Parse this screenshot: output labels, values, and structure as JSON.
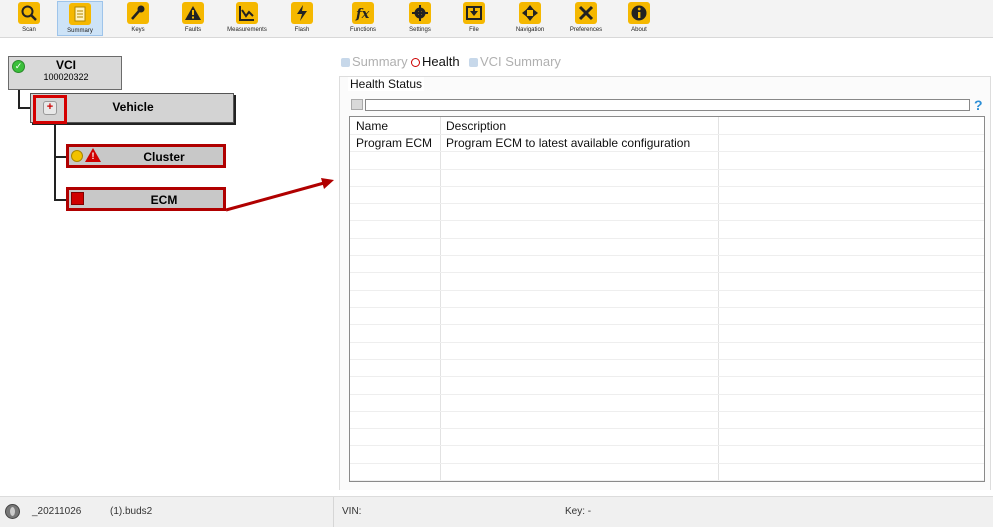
{
  "toolbar": {
    "buttons": [
      {
        "label": "Scan",
        "icon": "magnifier-icon"
      },
      {
        "label": "Summary",
        "icon": "document-icon"
      },
      {
        "label": "Keys",
        "icon": "key-icon"
      },
      {
        "label": "Faults",
        "icon": "warning-icon"
      },
      {
        "label": "Measurements",
        "icon": "chart-icon"
      },
      {
        "label": "Flash",
        "icon": "lightning-icon"
      },
      {
        "label": "Functions",
        "icon": "fx-icon"
      },
      {
        "label": "Settings",
        "icon": "gear-icon"
      },
      {
        "label": "File",
        "icon": "download-icon"
      },
      {
        "label": "Navigation",
        "icon": "navigation-arrows-icon"
      },
      {
        "label": "Preferences",
        "icon": "wrench-screwdriver-icon"
      },
      {
        "label": "About",
        "icon": "info-icon"
      }
    ],
    "accent_color": "#f5b800",
    "active": "Summary"
  },
  "tree": {
    "vci": {
      "title": "VCI",
      "serial": "100020322"
    },
    "vehicle": {
      "label": "Vehicle"
    },
    "cluster": {
      "label": "Cluster"
    },
    "ecm": {
      "label": "ECM"
    }
  },
  "tabs": {
    "summary": "Summary",
    "health": "Health",
    "vci_summary": "VCI Summary"
  },
  "health": {
    "title": "Health Status",
    "search_value": "",
    "help_glyph": "?",
    "columns": [
      "Name",
      "Description"
    ],
    "rows": [
      {
        "name": "Program ECM",
        "description": "Program ECM to latest available configuration"
      }
    ]
  },
  "status_bar": {
    "file_date": "_20211026",
    "file_name": "(1).buds2",
    "vin_label": "VIN:",
    "key_label": "Key: -"
  },
  "colors": {
    "highlight_red": "#b00000",
    "ok_green": "#3bbf3b",
    "warning_yellow": "#f2c200"
  }
}
